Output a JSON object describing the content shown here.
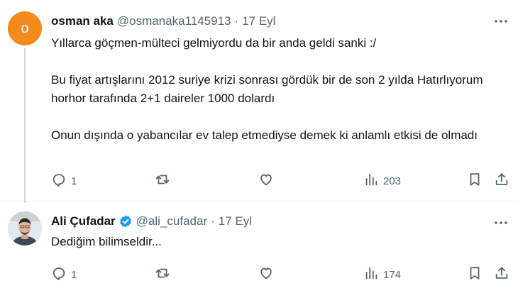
{
  "tweets": [
    {
      "avatar_letter": "o",
      "avatar_color": "#f28a1c",
      "name": "osman aka",
      "handle": "@osmanaka1145913",
      "separator": "·",
      "date": "17 Eyl",
      "paragraphs": [
        "Yıllarca göçmen-mülteci gelmiyordu da bir anda geldi sanki :/",
        "Bu fiyat artışlarını 2012 suriye krizi sonrası gördük bir de son 2 yılda Hatırlıyorum horhor tarafında 2+1 daireler 1000 dolardı",
        "Onun dışında o yabancılar ev talep etmediyse demek ki anlamlı etkisi de olmadı"
      ],
      "replies": "1",
      "views": "203"
    },
    {
      "name": "Ali Çufadar",
      "verified": true,
      "handle": "@ali_cufadar",
      "separator": "·",
      "date": "17 Eyl",
      "paragraphs": [
        "Dediğim bilimseldir..."
      ],
      "replies": "1",
      "views": "174"
    }
  ],
  "colors": {
    "text": "#0f1419",
    "secondary": "#536471",
    "verified_blue": "#1d9bf0",
    "thread_line": "#cfd9de"
  },
  "icons": [
    "more-icon",
    "reply-icon",
    "retweet-icon",
    "like-icon",
    "views-icon",
    "bookmark-icon",
    "share-icon",
    "verified-icon"
  ]
}
